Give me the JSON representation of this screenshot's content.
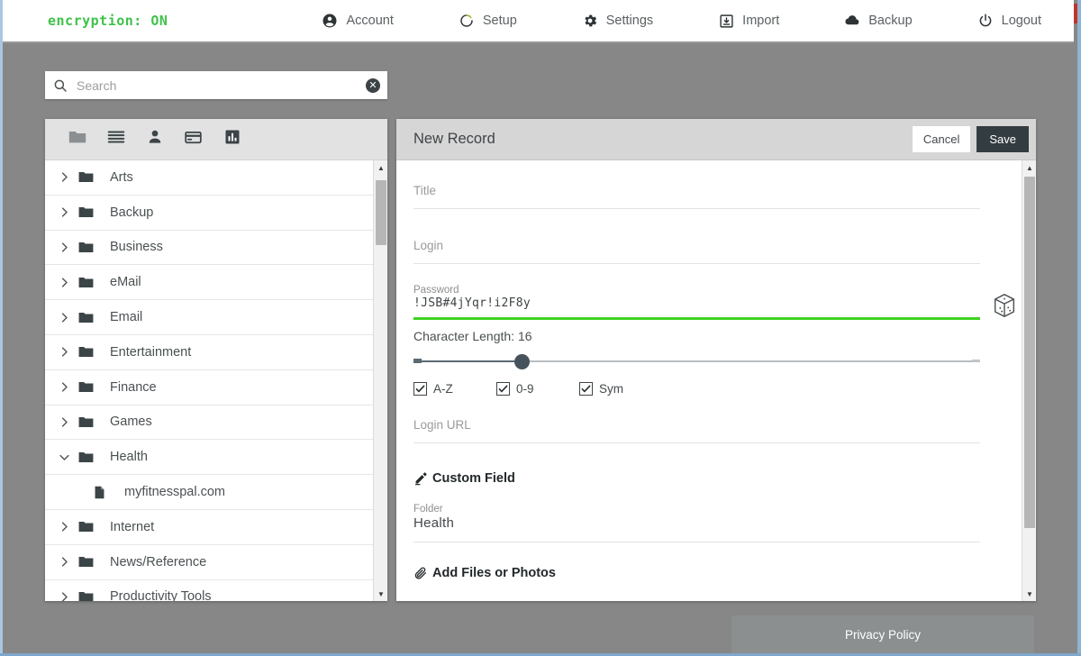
{
  "header": {
    "brand": "encryption: ON",
    "nav": [
      {
        "label": "Account",
        "icon": "account-icon"
      },
      {
        "label": "Setup",
        "icon": "setup-icon"
      },
      {
        "label": "Settings",
        "icon": "gear-icon"
      },
      {
        "label": "Import",
        "icon": "import-icon"
      },
      {
        "label": "Backup",
        "icon": "cloud-icon"
      },
      {
        "label": "Logout",
        "icon": "power-icon"
      }
    ]
  },
  "search": {
    "placeholder": "Search",
    "value": "",
    "clear_glyph": "✕"
  },
  "sidebar": {
    "tools": [
      {
        "name": "folders-tab",
        "icon": "folder-icon"
      },
      {
        "name": "notes-tab",
        "icon": "list-lines-icon"
      },
      {
        "name": "identities-tab",
        "icon": "person-icon"
      },
      {
        "name": "cards-tab",
        "icon": "credit-card-icon"
      },
      {
        "name": "reports-tab",
        "icon": "bar-chart-icon"
      }
    ],
    "tree": [
      {
        "label": "Arts",
        "type": "folder",
        "expanded": false
      },
      {
        "label": "Backup",
        "type": "folder",
        "expanded": false
      },
      {
        "label": "Business",
        "type": "folder",
        "expanded": false
      },
      {
        "label": "eMail",
        "type": "folder",
        "expanded": false
      },
      {
        "label": "Email",
        "type": "folder",
        "expanded": false
      },
      {
        "label": "Entertainment",
        "type": "folder",
        "expanded": false
      },
      {
        "label": "Finance",
        "type": "folder",
        "expanded": false
      },
      {
        "label": "Games",
        "type": "folder",
        "expanded": false
      },
      {
        "label": "Health",
        "type": "folder",
        "expanded": true
      },
      {
        "label": "myfitnesspal.com",
        "type": "record"
      },
      {
        "label": "Internet",
        "type": "folder",
        "expanded": false
      },
      {
        "label": "News/Reference",
        "type": "folder",
        "expanded": false
      },
      {
        "label": "Productivity Tools",
        "type": "folder",
        "expanded": false
      }
    ]
  },
  "record": {
    "title": "New Record",
    "cancel_label": "Cancel",
    "save_label": "Save",
    "fields": {
      "title_placeholder": "Title",
      "title_value": "",
      "login_placeholder": "Login",
      "login_value": "",
      "password_label": "Password",
      "password_value": "!JSB#4jYqr!i2F8y",
      "strength_color": "#3fd321",
      "length_label": "Character Length: 16",
      "length_value": 16,
      "slider_percent": 19,
      "checkboxes": [
        {
          "label": "A-Z",
          "checked": true
        },
        {
          "label": "0-9",
          "checked": true
        },
        {
          "label": "Sym",
          "checked": true
        }
      ],
      "url_placeholder": "Login URL",
      "url_value": "",
      "custom_field_label": "Custom Field",
      "folder_label": "Folder",
      "folder_value": "Health",
      "add_files_label": "Add Files or Photos"
    }
  },
  "footer": {
    "privacy_label": "Privacy Policy"
  }
}
